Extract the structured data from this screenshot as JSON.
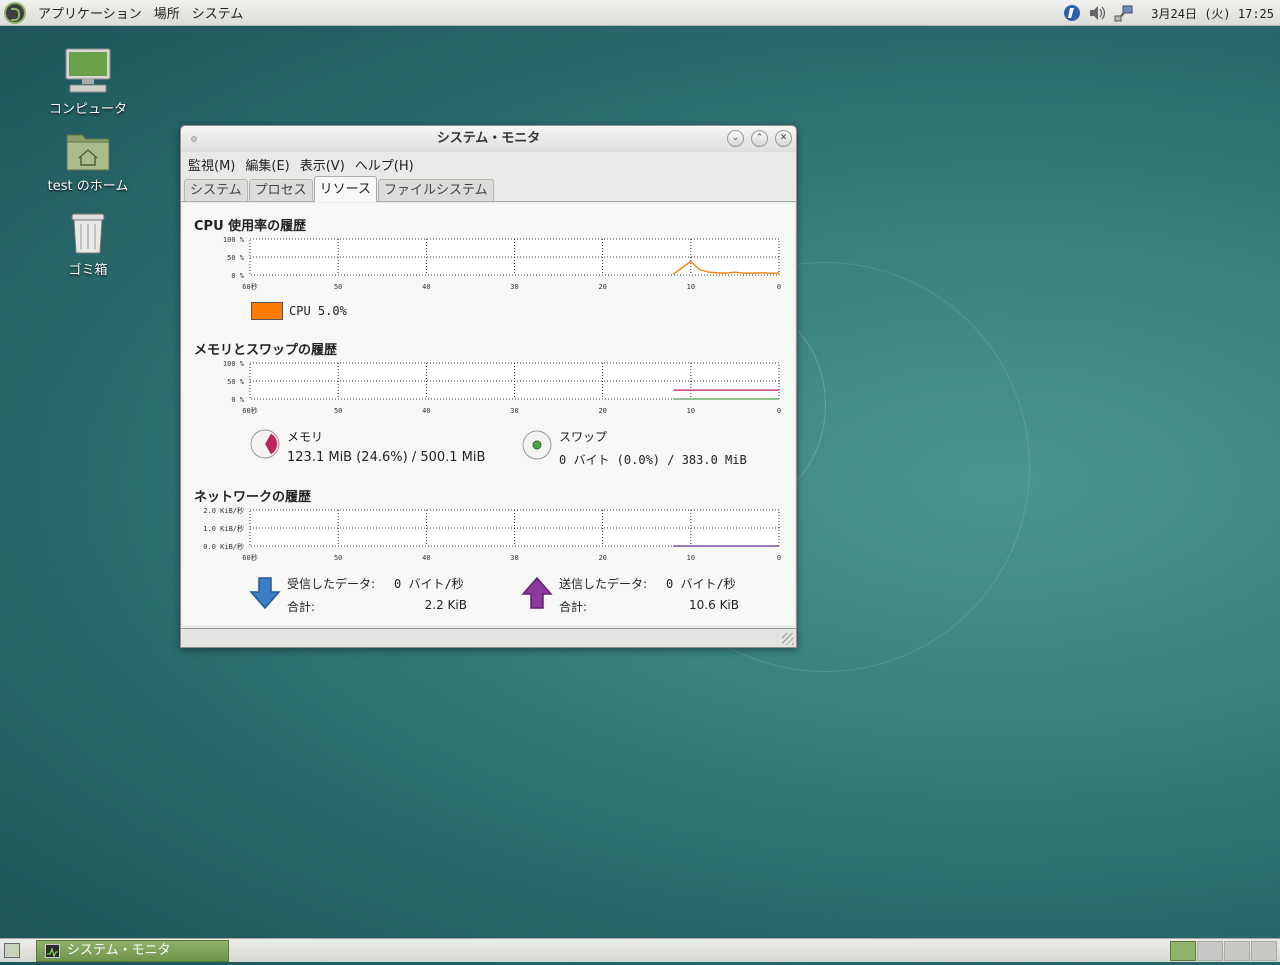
{
  "top_panel": {
    "menus": [
      "アプリケーション",
      "場所",
      "システム"
    ],
    "clock": "3月24日 (火) 17:25",
    "tray_icons": [
      "update-manager-icon",
      "volume-icon",
      "network-icon"
    ]
  },
  "desktop": {
    "icons": [
      {
        "label": "コンピュータ",
        "icon": "computer-icon"
      },
      {
        "label": "test のホーム",
        "icon": "home-folder-icon"
      },
      {
        "label": "ゴミ箱",
        "icon": "trash-icon"
      }
    ]
  },
  "window": {
    "title": "システム・モニタ",
    "menus": [
      "監視(M)",
      "編集(E)",
      "表示(V)",
      "ヘルプ(H)"
    ],
    "tabs": [
      "システム",
      "プロセス",
      "リソース",
      "ファイルシステム"
    ],
    "active_tab": "リソース"
  },
  "resources": {
    "cpu": {
      "title": "CPU 使用率の履歴",
      "y_ticks": [
        "100 %",
        "50 %",
        "0 %"
      ],
      "legend_label": "CPU 5.0%",
      "color": "#ff7b00"
    },
    "memory": {
      "title": "メモリとスワップの履歴",
      "y_ticks": [
        "100 %",
        "50 %",
        "0 %"
      ],
      "mem_label": "メモリ",
      "mem_value": "123.1 MiB (24.6%) / 500.1 MiB",
      "mem_color": "#c0245c",
      "swap_label": "スワップ",
      "swap_value": "0 バイト (0.0%) / 383.0 MiB",
      "swap_color": "#4ea24b"
    },
    "network": {
      "title": "ネットワークの履歴",
      "y_ticks": [
        "2.0 KiB/秒",
        "1.0 KiB/秒",
        "0.0 KiB/秒"
      ],
      "recv_label": "受信したデータ:",
      "recv_rate": "0 バイト/秒",
      "recv_total_label": "合計:",
      "recv_total": "2.2 KiB",
      "recv_color": "#3a7fc4",
      "sent_label": "送信したデータ:",
      "sent_rate": "0 バイト/秒",
      "sent_total_label": "合計:",
      "sent_total": "10.6 KiB",
      "sent_color": "#8a3b9a"
    },
    "x_ticks": [
      "60秒",
      "50",
      "40",
      "30",
      "20",
      "10",
      "0"
    ]
  },
  "chart_data": [
    {
      "type": "line",
      "title": "CPU 使用率の履歴",
      "x": [
        12,
        11,
        10,
        9,
        8,
        7,
        6,
        5,
        4,
        3,
        2,
        1,
        0
      ],
      "xlabel": "秒",
      "xlim": [
        60,
        0
      ],
      "ylim": [
        0,
        100
      ],
      "series": [
        {
          "name": "CPU",
          "values": [
            2,
            20,
            38,
            15,
            8,
            6,
            5,
            8,
            5,
            5,
            6,
            5,
            5
          ]
        }
      ]
    },
    {
      "type": "line",
      "title": "メモリとスワップの履歴",
      "x": [
        12,
        0
      ],
      "xlabel": "秒",
      "xlim": [
        60,
        0
      ],
      "ylim": [
        0,
        100
      ],
      "series": [
        {
          "name": "メモリ",
          "values": [
            24.6,
            24.6
          ]
        },
        {
          "name": "スワップ",
          "values": [
            0,
            0
          ]
        }
      ]
    },
    {
      "type": "line",
      "title": "ネットワークの履歴",
      "x": [
        12,
        0
      ],
      "xlabel": "秒",
      "xlim": [
        60,
        0
      ],
      "ylim": [
        0,
        2.0
      ],
      "series": [
        {
          "name": "受信したデータ",
          "values": [
            0,
            0
          ]
        },
        {
          "name": "送信したデータ",
          "values": [
            0,
            0
          ]
        }
      ]
    }
  ],
  "bottom_panel": {
    "task_label": "システム・モニタ",
    "workspaces": 4,
    "active_workspace": 1
  }
}
